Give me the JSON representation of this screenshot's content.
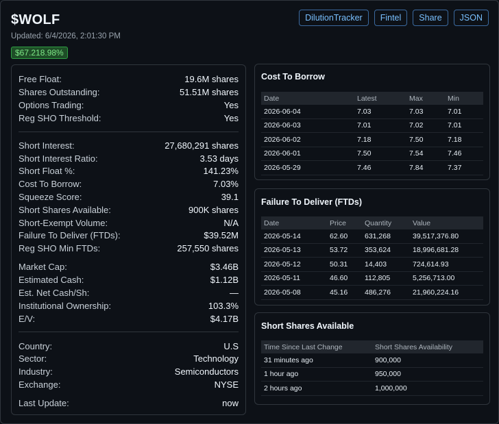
{
  "header": {
    "ticker": "$WOLF",
    "updated": "Updated: 6/4/2026, 2:01:30 PM",
    "change_badge": "$67.218.98%",
    "buttons": [
      "DilutionTracker",
      "Fintel",
      "Share",
      "JSON"
    ]
  },
  "stats": {
    "group1": [
      {
        "label": "Free Float:",
        "value": "19.6M shares"
      },
      {
        "label": "Shares Outstanding:",
        "value": "51.51M shares"
      },
      {
        "label": "Options Trading:",
        "value": "Yes"
      },
      {
        "label": "Reg SHO Threshold:",
        "value": "Yes"
      }
    ],
    "group2": [
      {
        "label": "Short Interest:",
        "value": "27,680,291 shares"
      },
      {
        "label": "Short Interest Ratio:",
        "value": "3.53 days"
      },
      {
        "label": "Short Float %:",
        "value": "141.23%"
      },
      {
        "label": "Cost To Borrow:",
        "value": "7.03%"
      },
      {
        "label": "Squeeze Score:",
        "value": "39.1"
      },
      {
        "label": "Short Shares Available:",
        "value": "900K shares"
      },
      {
        "label": "Short-Exempt Volume:",
        "value": "N/A"
      },
      {
        "label": "Failure To Deliver (FTDs):",
        "value": "$39.52M"
      },
      {
        "label": "Reg SHO Min FTDs:",
        "value": "257,550 shares"
      }
    ],
    "group3": [
      {
        "label": "Market Cap:",
        "value": "$3.46B"
      },
      {
        "label": "Estimated Cash:",
        "value": "$1.12B"
      },
      {
        "label": "Est. Net Cash/Sh:",
        "value": "—"
      },
      {
        "label": "Institutional Ownership:",
        "value": "103.3%"
      },
      {
        "label": "E/V:",
        "value": "$4.17B"
      }
    ],
    "group4": [
      {
        "label": "Country:",
        "value": "U.S"
      },
      {
        "label": "Sector:",
        "value": "Technology"
      },
      {
        "label": "Industry:",
        "value": "Semiconductors"
      },
      {
        "label": "Exchange:",
        "value": "NYSE"
      }
    ],
    "last_update": {
      "label": "Last Update:",
      "value": "now"
    }
  },
  "cost_to_borrow": {
    "title": "Cost To Borrow",
    "columns": [
      "Date",
      "Latest",
      "Max",
      "Min"
    ],
    "rows": [
      [
        "2026-06-04",
        "7.03",
        "7.03",
        "7.01"
      ],
      [
        "2026-06-03",
        "7.01",
        "7.02",
        "7.01"
      ],
      [
        "2026-06-02",
        "7.18",
        "7.50",
        "7.18"
      ],
      [
        "2026-06-01",
        "7.50",
        "7.54",
        "7.46"
      ],
      [
        "2026-05-29",
        "7.46",
        "7.84",
        "7.37"
      ]
    ]
  },
  "ftd": {
    "title": "Failure To Deliver (FTDs)",
    "columns": [
      "Date",
      "Price",
      "Quantity",
      "Value"
    ],
    "rows": [
      [
        "2026-05-14",
        "62.60",
        "631,268",
        "39,517,376.80"
      ],
      [
        "2026-05-13",
        "53.72",
        "353,624",
        "18,996,681.28"
      ],
      [
        "2026-05-12",
        "50.31",
        "14,403",
        "724,614.93"
      ],
      [
        "2026-05-11",
        "46.60",
        "112,805",
        "5,256,713.00"
      ],
      [
        "2026-05-08",
        "45.16",
        "486,276",
        "21,960,224.16"
      ]
    ]
  },
  "ssa": {
    "title": "Short Shares Available",
    "columns": [
      "Time Since Last Change",
      "Short Shares Availability"
    ],
    "rows": [
      [
        "31 minutes ago",
        "900,000"
      ],
      [
        "1 hour ago",
        "950,000"
      ],
      [
        "2 hours ago",
        "1,000,000"
      ]
    ]
  },
  "colors": {
    "background": "#0d1117",
    "border": "#30363d",
    "link": "#79c0ff",
    "badge_bg": "#1e4d27",
    "badge_text": "#7ee787"
  }
}
